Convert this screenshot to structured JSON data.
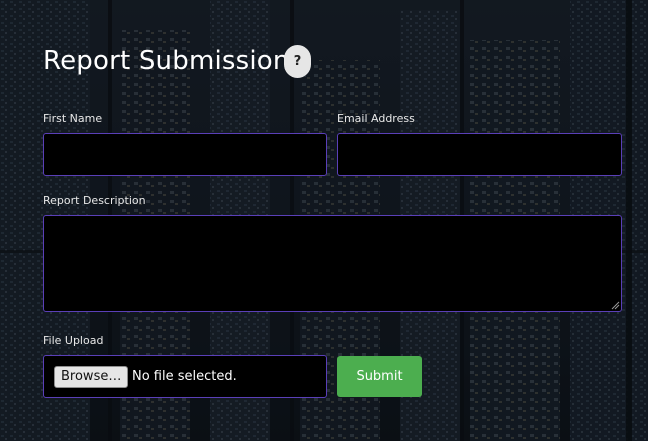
{
  "form": {
    "title": "Report Submission",
    "help_label": "?",
    "first_name": {
      "label": "First Name",
      "value": "",
      "placeholder": ""
    },
    "email": {
      "label": "Email Address",
      "value": "",
      "placeholder": ""
    },
    "description": {
      "label": "Report Description",
      "value": "",
      "placeholder": ""
    },
    "file_upload": {
      "label": "File Upload",
      "browse_label": "Browse…",
      "status": "No file selected."
    },
    "submit_label": "Submit"
  },
  "colors": {
    "field_border": "#5a3fb8",
    "field_background": "#000000",
    "submit_background": "#4cae4f",
    "help_background": "#e6e6e6"
  }
}
